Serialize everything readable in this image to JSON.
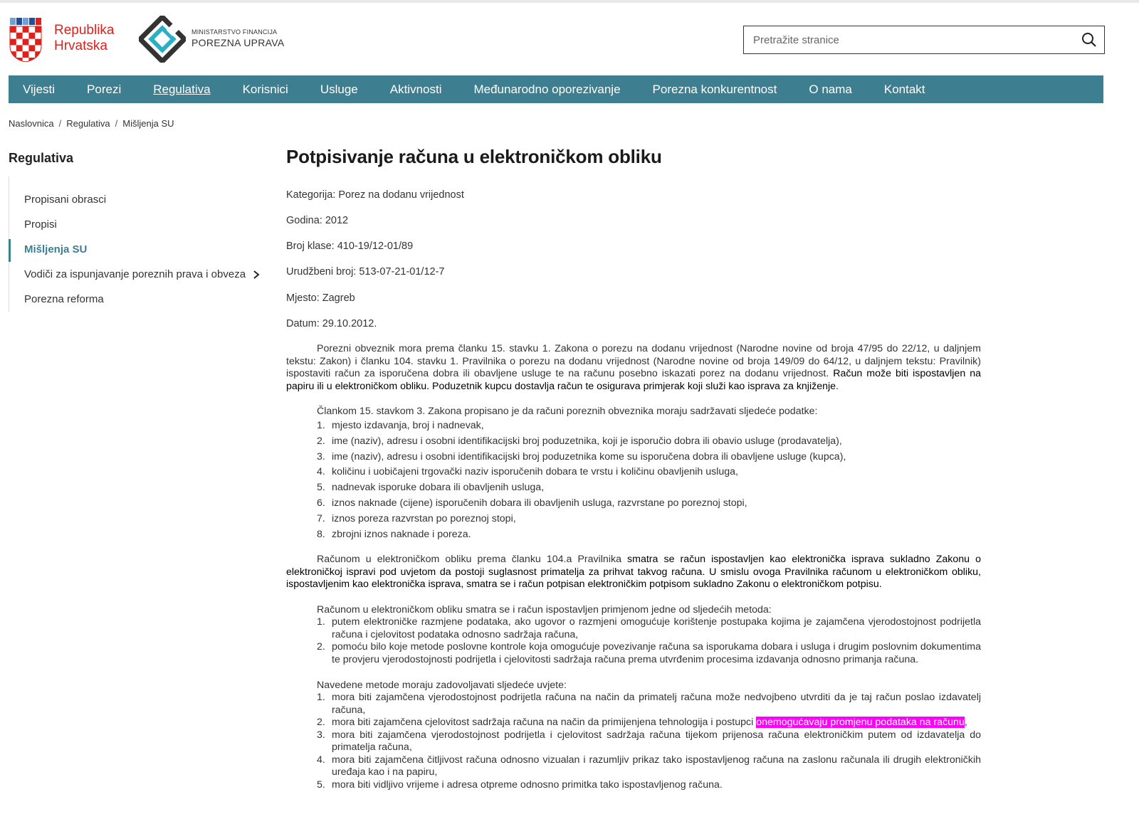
{
  "header": {
    "brand_line1": "Republika",
    "brand_line2": "Hrvatska",
    "ministry_small": "MINISTARSTVO FINANCIJA",
    "ministry_big": "POREZNA UPRAVA",
    "search_placeholder": "Pretražite stranice"
  },
  "nav": {
    "items": [
      {
        "label": "Vijesti"
      },
      {
        "label": "Porezi"
      },
      {
        "label": "Regulativa"
      },
      {
        "label": "Korisnici"
      },
      {
        "label": "Usluge"
      },
      {
        "label": "Aktivnosti"
      },
      {
        "label": "Međunarodno oporezivanje"
      },
      {
        "label": "Porezna konkurentnost"
      },
      {
        "label": "O nama"
      },
      {
        "label": "Kontakt"
      }
    ]
  },
  "breadcrumb": {
    "items": [
      {
        "label": "Naslovnica"
      },
      {
        "label": "Regulativa"
      },
      {
        "label": "Mišljenja SU"
      }
    ],
    "separator": "/"
  },
  "sidebar": {
    "title": "Regulativa",
    "items": [
      {
        "label": "Propisani obrasci"
      },
      {
        "label": "Propisi"
      },
      {
        "label": "Mišljenja SU"
      },
      {
        "label": "Vodiči za ispunjavanje poreznih prava i obveza"
      },
      {
        "label": "Porezna reforma"
      }
    ]
  },
  "article": {
    "title": "Potpisivanje računa u elektroničkom obliku",
    "meta": {
      "kategorija": "Kategorija: Porez na dodanu vrijednost",
      "godina": "Godina: 2012",
      "klasa": "Broj klase: 410-19/12-01/89",
      "urudzbeni": "Urudžbeni broj: 513-07-21-01/12-7",
      "mjesto": "Mjesto: Zagreb",
      "datum": "Datum: 29.10.2012."
    },
    "p1_a": "Porezni obveznik mora prema članku 15. stavku 1. Zakona o porezu na dodanu vrijednost (Narodne novine od broja 47/95 do 22/12, u daljnjem tekstu: Zakon) i članku 104. stavku 1. Pravilnika o porezu na dodanu vrijednost (Narodne novine od broja 149/09 do 64/12, u daljnjem tekstu: Pravilnik) ispostaviti račun za isporučena dobra ili obavljene usluge te na računu posebno iskazati porez na dodanu vrijednost. ",
    "p1_b": "Račun može biti ispostavljen na papiru ili u elektroničkom obliku. Poduzetnik kupcu dostavlja račun te osigurava primjerak koji služi kao isprava za knjiženje",
    "p1_c": ".",
    "list1_intro": "Člankom 15. stavkom 3. Zakona propisano je da računi poreznih obveznika moraju sadržavati sljedeće podatke:",
    "list1": [
      {
        "num": "1.",
        "text": "mjesto izdavanja, broj i nadnevak,"
      },
      {
        "num": "2.",
        "text": "ime (naziv), adresu i osobni identifikacijski broj poduzetnika, koji je isporučio dobra ili obavio usluge (prodavatelja),"
      },
      {
        "num": "3.",
        "text": "ime (naziv), adresu i osobni identifikacijski broj poduzetnika kome su isporučena dobra ili obavljene usluge (kupca),"
      },
      {
        "num": "4.",
        "text": "količinu i uobičajeni trgovački naziv isporučenih dobara te vrstu i količinu obavljenih usluga,"
      },
      {
        "num": "5.",
        "text": "nadnevak isporuke dobara ili obavljenih usluga,"
      },
      {
        "num": "6.",
        "text": "iznos naknade (cijene) isporučenih dobara ili obavljenih usluga, razvrstane po poreznoj stopi,"
      },
      {
        "num": "7.",
        "text": "iznos poreza razvrstan po poreznoj stopi,"
      },
      {
        "num": "8.",
        "text": "zbrojni iznos naknade i poreza."
      }
    ],
    "p2_a": "Računom u elektroničkom obliku prema članku 104.a Pravilnika ",
    "p2_b": "smatra se račun ispostavljen kao elektronička isprava sukladno Zakonu o elektroničkoj ispravi pod uvjetom da postoji suglasnost primatelja za prihvat takvog računa. U smislu ovoga Pravilnika računom u elektroničkom obliku, ispostavljenim kao elektronička isprava, smatra se i račun potpisan elektroničkim potpisom sukladno Zakonu o elektroničkom potpisu.",
    "list2_intro": "Računom u elektroničkom obliku smatra se i račun ispostavljen primjenom jedne od sljedećih metoda:",
    "list2": [
      {
        "num": "1.",
        "text": "putem elektroničke razmjene podataka, ako ugovor o razmjeni omogućuje korištenje postupaka kojima je zajamčena vjerodostojnost podrijetla računa i cjelovitost podataka odnosno sadržaja računa,"
      },
      {
        "num": "2.",
        "text": "pomoću bilo koje metode poslovne kontrole koja omogućuje povezivanje računa sa isporukama dobara i usluga i drugim poslovnim dokumentima te provjeru vjerodostojnosti podrijetla i cjelovitosti sadržaja računa prema utvrđenim procesima izdavanja odnosno primanja računa."
      }
    ],
    "list3_intro": "Navedene metode moraju zadovoljavati sljedeće uvjete:",
    "list3": [
      {
        "num": "1.",
        "text": "mora biti zajamčena vjerodostojnost podrijetla računa na način da primatelj računa može nedvojbeno utvrditi da je taj račun poslao izdavatelj računa,"
      },
      {
        "num": "2.",
        "text_a": "mora biti zajamčena cjelovitost sadržaja računa na način da primijenjena tehnologija i postupci ",
        "text_hl": "onemogućavaju promjenu podataka na računu",
        "text_c": ","
      },
      {
        "num": "3.",
        "text": "mora biti zajamčena vjerodostojnost podrijetla i cjelovitost sadržaja računa tijekom prijenosa računa elektroničkim putem od izdavatelja do primatelja računa,"
      },
      {
        "num": "4.",
        "text": "mora biti zajamčena čitljivost računa odnosno vizualan i razumljiv prikaz tako ispostavljenog računa na zaslonu računala ili drugih elektroničkih uređaja kao i na papiru,"
      },
      {
        "num": "5.",
        "text": "mora biti vidljivo vrijeme i adresa otpreme odnosno primitka tako ispostavljenog računa."
      }
    ]
  },
  "colors": {
    "nav_bg": "#3d7e90",
    "brand_red": "#e0201b",
    "highlight": "#ff00ff"
  }
}
